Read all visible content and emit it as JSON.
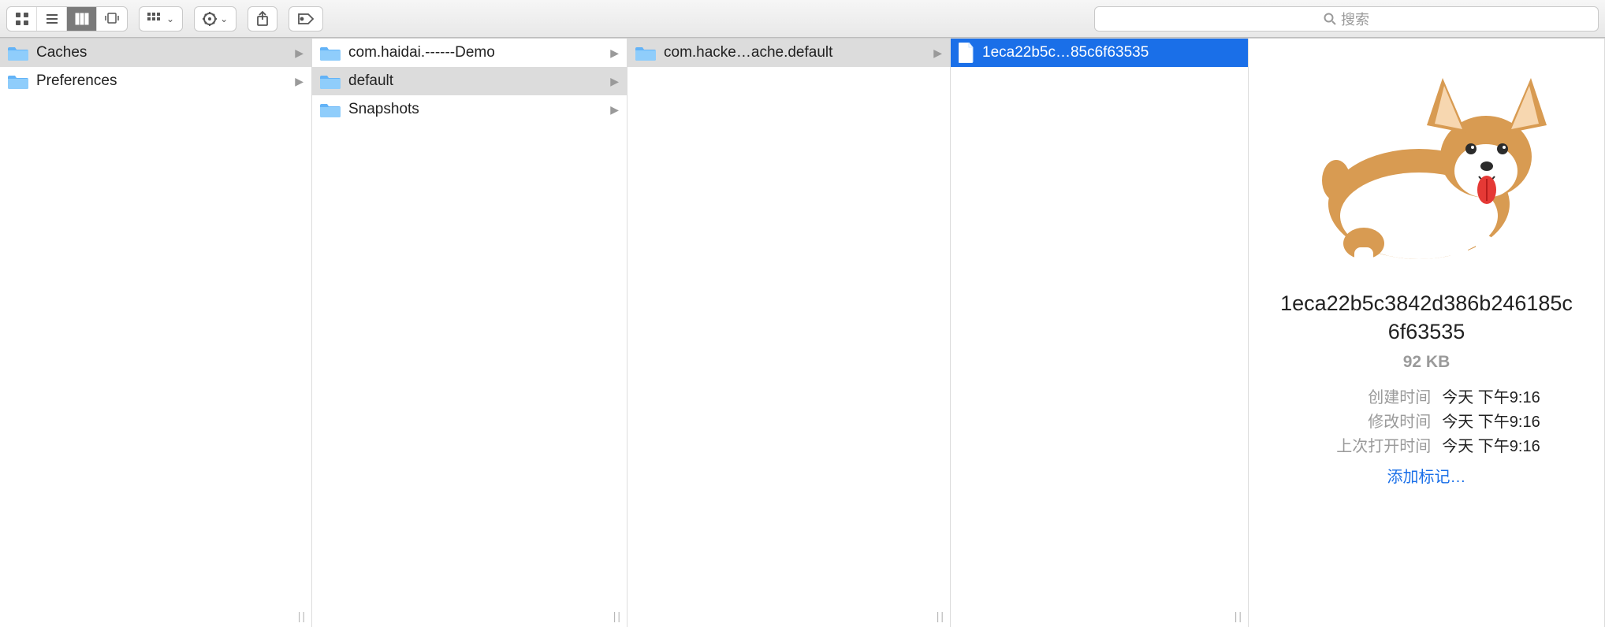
{
  "search": {
    "placeholder": "搜索"
  },
  "columns": [
    {
      "items": [
        {
          "name": "Caches",
          "type": "folder",
          "hasChildren": true,
          "selected": "grey"
        },
        {
          "name": "Preferences",
          "type": "folder",
          "hasChildren": true
        }
      ]
    },
    {
      "items": [
        {
          "name": "com.haidai.------Demo",
          "type": "folder",
          "hasChildren": true
        },
        {
          "name": "default",
          "type": "folder",
          "hasChildren": true,
          "selected": "grey"
        },
        {
          "name": "Snapshots",
          "type": "folder",
          "hasChildren": true
        }
      ]
    },
    {
      "items": [
        {
          "name": "com.hacke…ache.default",
          "type": "folder",
          "hasChildren": true,
          "selected": "grey"
        }
      ]
    },
    {
      "items": [
        {
          "name": "1eca22b5c…85c6f63535",
          "type": "file",
          "selected": "blue"
        }
      ]
    }
  ],
  "preview": {
    "filename": "1eca22b5c3842d386b246185c6f63535",
    "size": "92 KB",
    "meta": [
      {
        "label": "创建时间",
        "value": "今天 下午9:16"
      },
      {
        "label": "修改时间",
        "value": "今天 下午9:16"
      },
      {
        "label": "上次打开时间",
        "value": "今天 下午9:16"
      }
    ],
    "add_tags": "添加标记…"
  }
}
